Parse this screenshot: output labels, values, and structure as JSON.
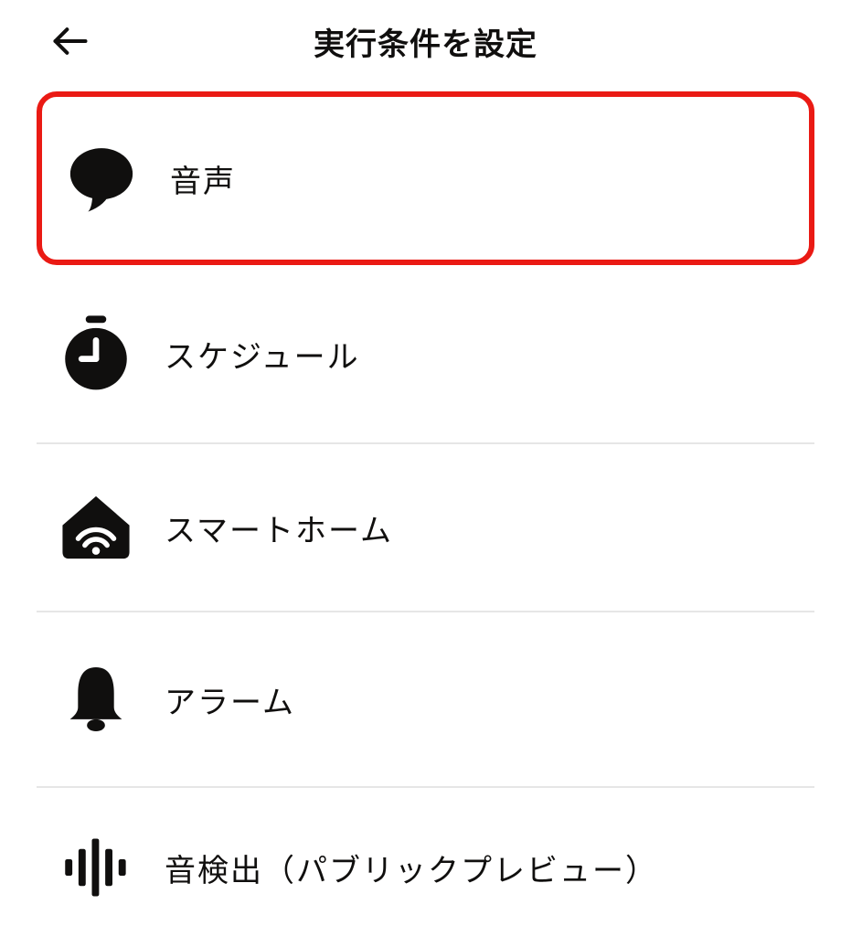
{
  "header": {
    "title": "実行条件を設定"
  },
  "items": [
    {
      "label": "音声",
      "icon": "speech-icon",
      "highlighted": true
    },
    {
      "label": "スケジュール",
      "icon": "clock-icon",
      "highlighted": false
    },
    {
      "label": "スマートホーム",
      "icon": "smart-home-icon",
      "highlighted": false
    },
    {
      "label": "アラーム",
      "icon": "alarm-bell-icon",
      "highlighted": false
    },
    {
      "label": "音検出（パブリックプレビュー）",
      "icon": "sound-wave-icon",
      "highlighted": false
    }
  ]
}
